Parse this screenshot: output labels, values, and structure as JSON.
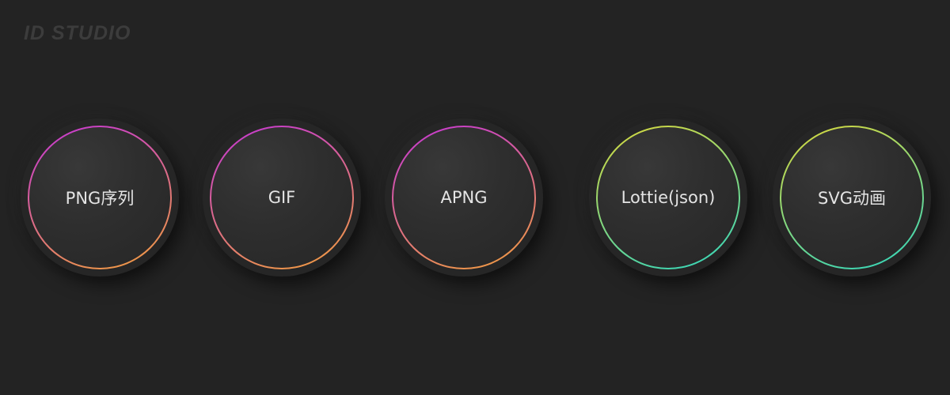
{
  "logo": {
    "text": "ID STUDIO"
  },
  "formats": [
    {
      "label": "PNG序列",
      "ring_colors": [
        "#c535d8",
        "#f2a03a"
      ]
    },
    {
      "label": "GIF",
      "ring_colors": [
        "#c535d8",
        "#f2a03a"
      ]
    },
    {
      "label": "APNG",
      "ring_colors": [
        "#c535d8",
        "#f2a03a"
      ]
    },
    {
      "label": "Lottie(json)",
      "ring_colors": [
        "#dcd83a",
        "#2ed6c0"
      ]
    },
    {
      "label": "SVG动画",
      "ring_colors": [
        "#dcd83a",
        "#2ed6c0"
      ]
    }
  ]
}
